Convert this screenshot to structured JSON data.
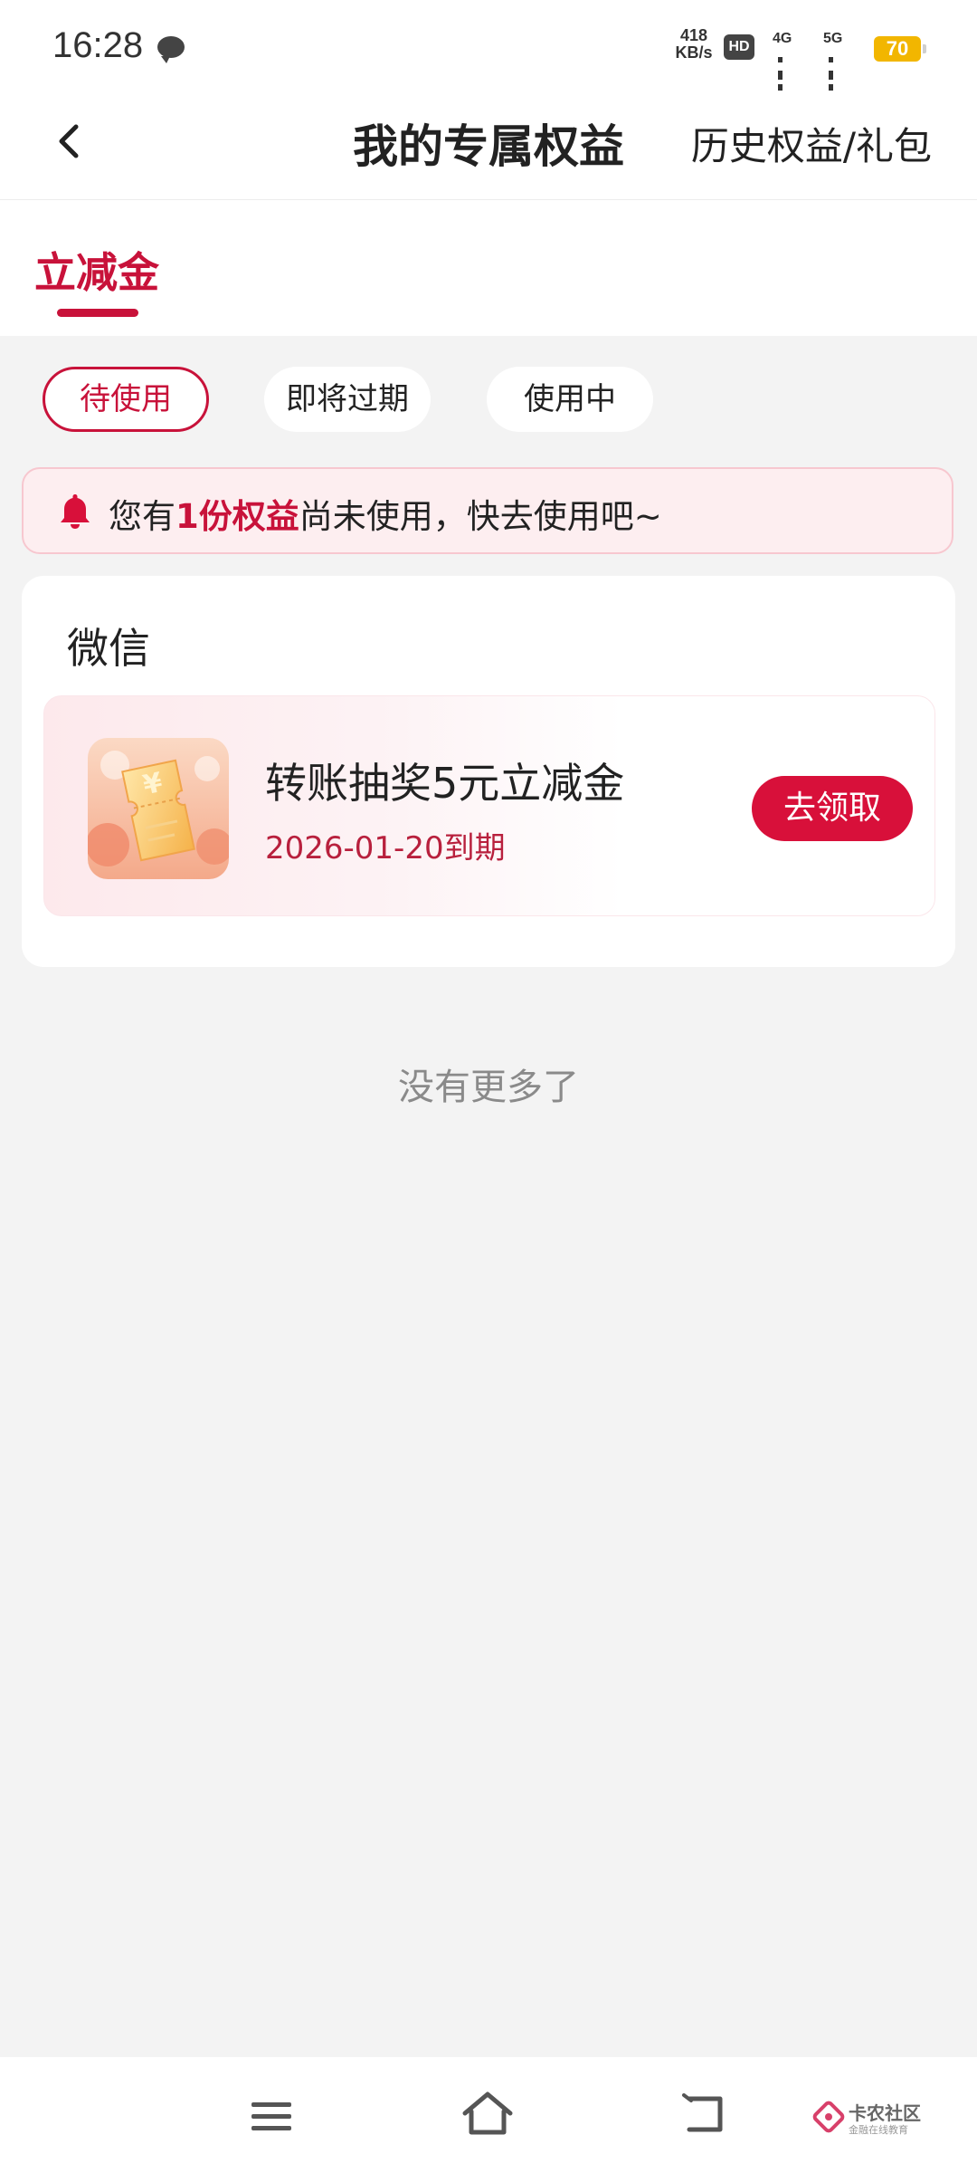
{
  "status_bar": {
    "time": "16:28",
    "net_speed_value": "418",
    "net_speed_unit": "KB/s",
    "hd_label": "HD",
    "sim1_label": "4G",
    "sim2_label": "5G",
    "battery_level": "70"
  },
  "nav": {
    "title": "我的专属权益",
    "history_link": "历史权益/礼包"
  },
  "tabs": [
    {
      "label": "立减金",
      "active": true
    }
  ],
  "filters": [
    {
      "label": "待使用",
      "active": true
    },
    {
      "label": "即将过期",
      "active": false
    },
    {
      "label": "使用中",
      "active": false
    }
  ],
  "notice": {
    "prefix": "您有",
    "highlight": "1份权益",
    "suffix": "尚未使用，快去使用吧~"
  },
  "card": {
    "title": "微信",
    "items": [
      {
        "name": "转账抽奖5元立减金",
        "expire": "2026-01-20到期",
        "action": "去领取"
      }
    ]
  },
  "footer_text": "没有更多了",
  "watermark": {
    "name": "卡农社区",
    "sub": "金融在线教育"
  },
  "colors": {
    "accent": "#c8123a",
    "button": "#d8103a",
    "battery": "#f2b600",
    "background": "#f3f3f3"
  }
}
